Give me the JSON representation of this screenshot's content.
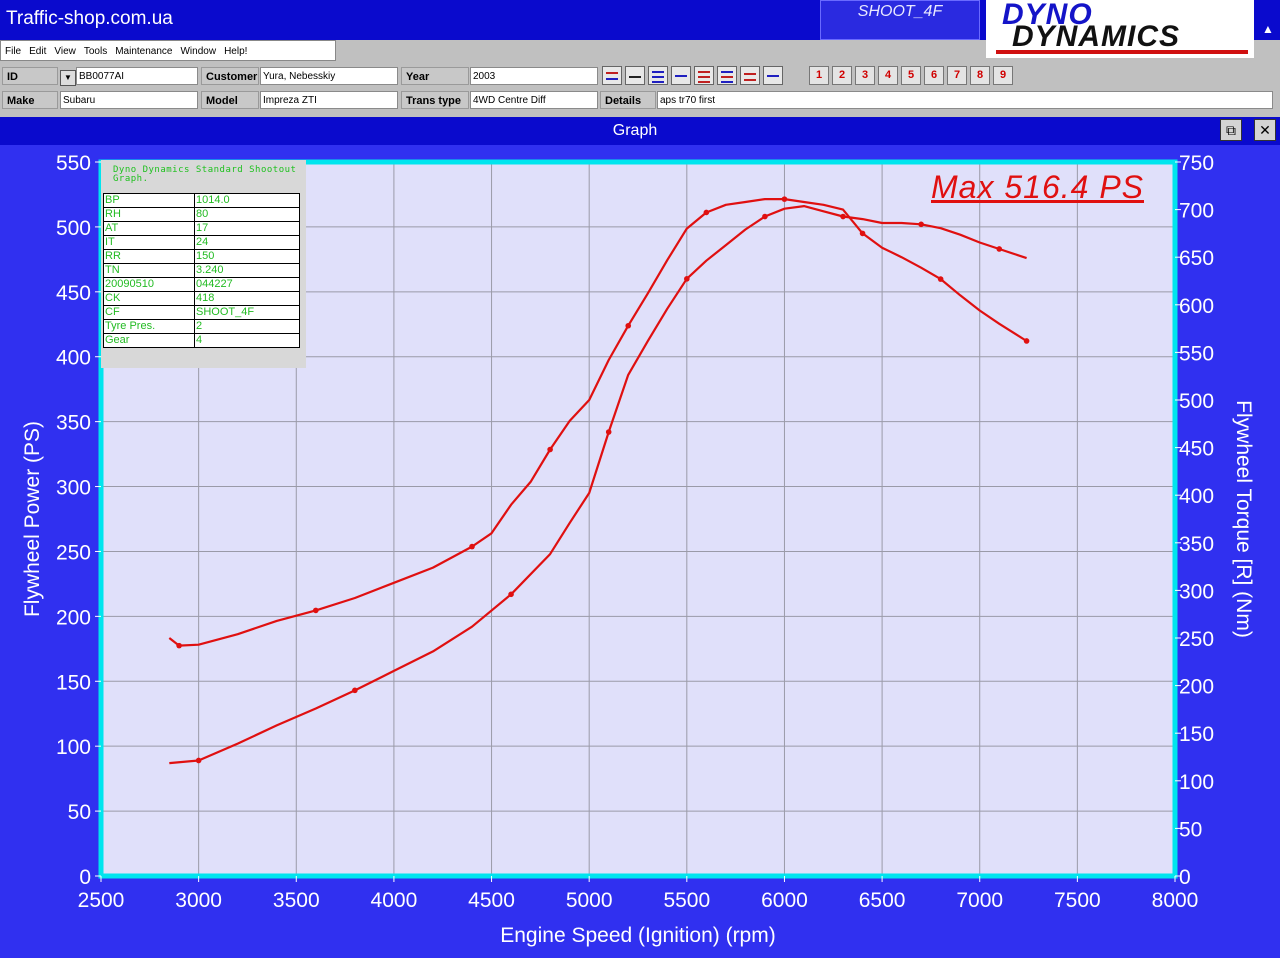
{
  "app": {
    "title": "Traffic-shop.com.ua",
    "shoot_label": "SHOOT_4F",
    "logo_line1": "DYNO",
    "logo_line2": "DYNAMICS"
  },
  "menu": [
    "File",
    "Edit",
    "View",
    "Tools",
    "Maintenance",
    "Window",
    "Help!"
  ],
  "fields": {
    "id_label": "ID",
    "id_value": "BB0077AI",
    "customer_label": "Customer",
    "customer_value": "Yura, Nebesskiy",
    "year_label": "Year",
    "year_value": "2003",
    "make_label": "Make",
    "make_value": "Subaru",
    "model_label": "Model",
    "model_value": "Impreza ZTI",
    "trans_label": "Trans type",
    "trans_value": "4WD Centre Diff",
    "details_label": "Details",
    "details_value": "aps tr70 first"
  },
  "run_buttons": [
    "1",
    "2",
    "3",
    "4",
    "5",
    "6",
    "7",
    "8",
    "9"
  ],
  "window": {
    "title": "Graph",
    "restore": "⧉",
    "close": "✕"
  },
  "legend": {
    "title": "Dyno Dynamics Standard Shootout Graph.",
    "rows": [
      [
        "BP",
        "1014.0"
      ],
      [
        "RH",
        "80"
      ],
      [
        "AT",
        "17"
      ],
      [
        "IT",
        "24"
      ],
      [
        "RR",
        "150"
      ],
      [
        "TN",
        "3.240"
      ],
      [
        "20090510",
        "044227"
      ],
      [
        "CK",
        "418"
      ],
      [
        "CF",
        "SHOOT_4F"
      ],
      [
        "Tyre Pres.",
        "2"
      ],
      [
        "Gear",
        "4"
      ]
    ]
  },
  "max_label": "Max 516.4 PS",
  "colors": {
    "plot_bg": "#e0e0fa",
    "frame": "#3030f0",
    "axis": "#00e5ee",
    "curve": "#e01010"
  },
  "chart_data": {
    "type": "line",
    "xlabel": "Engine Speed (Ignition) (rpm)",
    "ylabel": "Flywheel Power (PS)",
    "y2label": "Flywheel Torque [R] (Nm)",
    "xlim": [
      2500,
      8000
    ],
    "ylim": [
      0,
      550
    ],
    "y2lim": [
      0,
      750
    ],
    "xticks": [
      2500,
      3000,
      3500,
      4000,
      4500,
      5000,
      5500,
      6000,
      6500,
      7000,
      7500,
      8000
    ],
    "yticks": [
      0,
      50,
      100,
      150,
      200,
      250,
      300,
      350,
      400,
      450,
      500,
      550
    ],
    "y2ticks": [
      0,
      50,
      100,
      150,
      200,
      250,
      300,
      350,
      400,
      450,
      500,
      550,
      600,
      650,
      700,
      750
    ],
    "grid": true,
    "series": [
      {
        "axis": "left",
        "points": [
          [
            2850,
            87
          ],
          [
            3000,
            89
          ],
          [
            3200,
            102
          ],
          [
            3400,
            116
          ],
          [
            3600,
            129
          ],
          [
            3800,
            143
          ],
          [
            4000,
            158
          ],
          [
            4200,
            173
          ],
          [
            4400,
            192
          ],
          [
            4600,
            217
          ],
          [
            4800,
            248
          ],
          [
            4900,
            272
          ],
          [
            5000,
            295
          ],
          [
            5100,
            342
          ],
          [
            5200,
            386
          ],
          [
            5300,
            412
          ],
          [
            5400,
            437
          ],
          [
            5500,
            460
          ],
          [
            5600,
            474
          ],
          [
            5700,
            486
          ],
          [
            5800,
            498
          ],
          [
            5900,
            508
          ],
          [
            6000,
            514
          ],
          [
            6100,
            516
          ],
          [
            6200,
            512
          ],
          [
            6300,
            508
          ],
          [
            6400,
            506
          ],
          [
            6500,
            503
          ],
          [
            6600,
            503
          ],
          [
            6700,
            502
          ],
          [
            6800,
            499
          ],
          [
            6900,
            494
          ],
          [
            7000,
            488
          ],
          [
            7100,
            483
          ],
          [
            7240,
            476
          ]
        ]
      },
      {
        "axis": "right",
        "points": [
          [
            2850,
            250
          ],
          [
            2900,
            242
          ],
          [
            3000,
            243
          ],
          [
            3200,
            254
          ],
          [
            3400,
            268
          ],
          [
            3600,
            279
          ],
          [
            3800,
            292
          ],
          [
            4000,
            308
          ],
          [
            4200,
            324
          ],
          [
            4400,
            346
          ],
          [
            4500,
            360
          ],
          [
            4600,
            390
          ],
          [
            4700,
            414
          ],
          [
            4800,
            448
          ],
          [
            4900,
            478
          ],
          [
            5000,
            500
          ],
          [
            5100,
            542
          ],
          [
            5200,
            578
          ],
          [
            5300,
            612
          ],
          [
            5400,
            647
          ],
          [
            5500,
            680
          ],
          [
            5600,
            697
          ],
          [
            5700,
            705
          ],
          [
            5800,
            708
          ],
          [
            5900,
            711
          ],
          [
            6000,
            711
          ],
          [
            6100,
            708
          ],
          [
            6200,
            705
          ],
          [
            6300,
            700
          ],
          [
            6400,
            675
          ],
          [
            6500,
            660
          ],
          [
            6600,
            650
          ],
          [
            6700,
            639
          ],
          [
            6800,
            627
          ],
          [
            6900,
            610
          ],
          [
            7000,
            594
          ],
          [
            7100,
            580
          ],
          [
            7240,
            562
          ]
        ]
      }
    ]
  }
}
